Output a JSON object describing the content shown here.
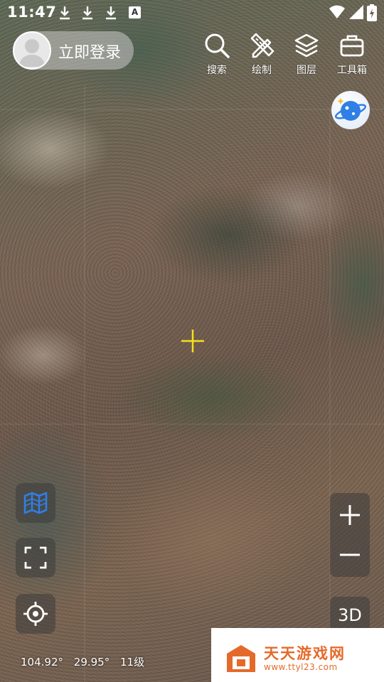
{
  "status_bar": {
    "time": "11:47",
    "download_icons": [
      "download-icon",
      "download-icon",
      "download-icon"
    ],
    "notification_badge": "A"
  },
  "account": {
    "login_label": "立即登录"
  },
  "toolbar": {
    "items": [
      {
        "label": "搜索",
        "icon": "search-icon"
      },
      {
        "label": "绘制",
        "icon": "pencil-ruler-icon"
      },
      {
        "label": "图层",
        "icon": "layers-icon"
      },
      {
        "label": "工具箱",
        "icon": "toolbox-icon"
      }
    ]
  },
  "map": {
    "zoom_in": "+",
    "zoom_out": "−",
    "view_3d_label": "3D",
    "coords": {
      "longitude": "104.92°",
      "latitude": "29.95°",
      "level": "11级"
    }
  },
  "watermark": {
    "title": "天天游戏网",
    "url": "www.ttyl23.com"
  },
  "colors": {
    "crosshair": "#f3e21a",
    "accent_blue": "#2f7fe6",
    "watermark": "#e56a2a"
  }
}
